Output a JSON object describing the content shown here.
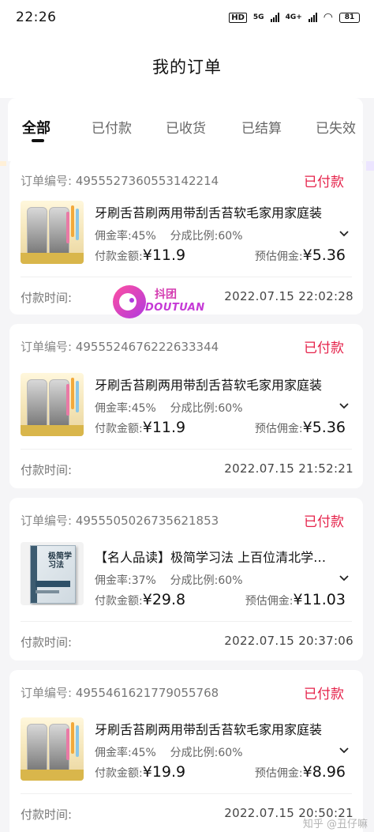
{
  "status_bar": {
    "time": "22:26",
    "hd": "HD",
    "net1": "5G",
    "net2": "4G+",
    "battery": "81"
  },
  "header": {
    "title": "我的订单"
  },
  "tabs": [
    {
      "label": "全部",
      "active": true
    },
    {
      "label": "已付款",
      "active": false
    },
    {
      "label": "已收货",
      "active": false
    },
    {
      "label": "已结算",
      "active": false
    },
    {
      "label": "已失效",
      "active": false
    }
  ],
  "labels": {
    "order_no": "订单编号:",
    "commission_rate": "佣金率:",
    "split_ratio": "分成比例:",
    "paid_amount": "付款金额:",
    "est_commission": "预估佣金:",
    "pay_time": "付款时间:",
    "currency": "¥"
  },
  "orders": [
    {
      "order_no": "4955527360553142214",
      "status": "已付款",
      "product": "牙刷舌苔刷两用带刮舌苔软毛家用家庭装",
      "commission_rate": "45%",
      "split_ratio": "60%",
      "paid_amount": "11.9",
      "est_commission": "5.36",
      "pay_time": "2022.07.15 22:02:28",
      "thumb": "toothbrush-jar"
    },
    {
      "order_no": "4955524676222633344",
      "status": "已付款",
      "product": "牙刷舌苔刷两用带刮舌苔软毛家用家庭装",
      "commission_rate": "45%",
      "split_ratio": "60%",
      "paid_amount": "11.9",
      "est_commission": "5.36",
      "pay_time": "2022.07.15 21:52:21",
      "thumb": "toothbrush-jar"
    },
    {
      "order_no": "4955505026735621853",
      "status": "已付款",
      "product": "【名人品读】极简学习法 上百位清北学…",
      "commission_rate": "37%",
      "split_ratio": "60%",
      "paid_amount": "29.8",
      "est_commission": "11.03",
      "pay_time": "2022.07.15 20:37:06",
      "thumb": "book-cover",
      "book_title": "极简学习法"
    },
    {
      "order_no": "4955461621779055768",
      "status": "已付款",
      "product": "牙刷舌苔刷两用带刮舌苔软毛家用家庭装",
      "commission_rate": "45%",
      "split_ratio": "60%",
      "paid_amount": "19.9",
      "est_commission": "8.96",
      "pay_time": "2022.07.15 20:50:21",
      "thumb": "toothbrush-jar"
    }
  ],
  "watermark": {
    "logo_cn": "抖团",
    "logo_en": "DOUTUAN",
    "corner_tag": "知乎 @丑仔嘛"
  },
  "colors": {
    "status_red": "#e5224a",
    "background": "#f5f5f7",
    "card": "#ffffff"
  }
}
